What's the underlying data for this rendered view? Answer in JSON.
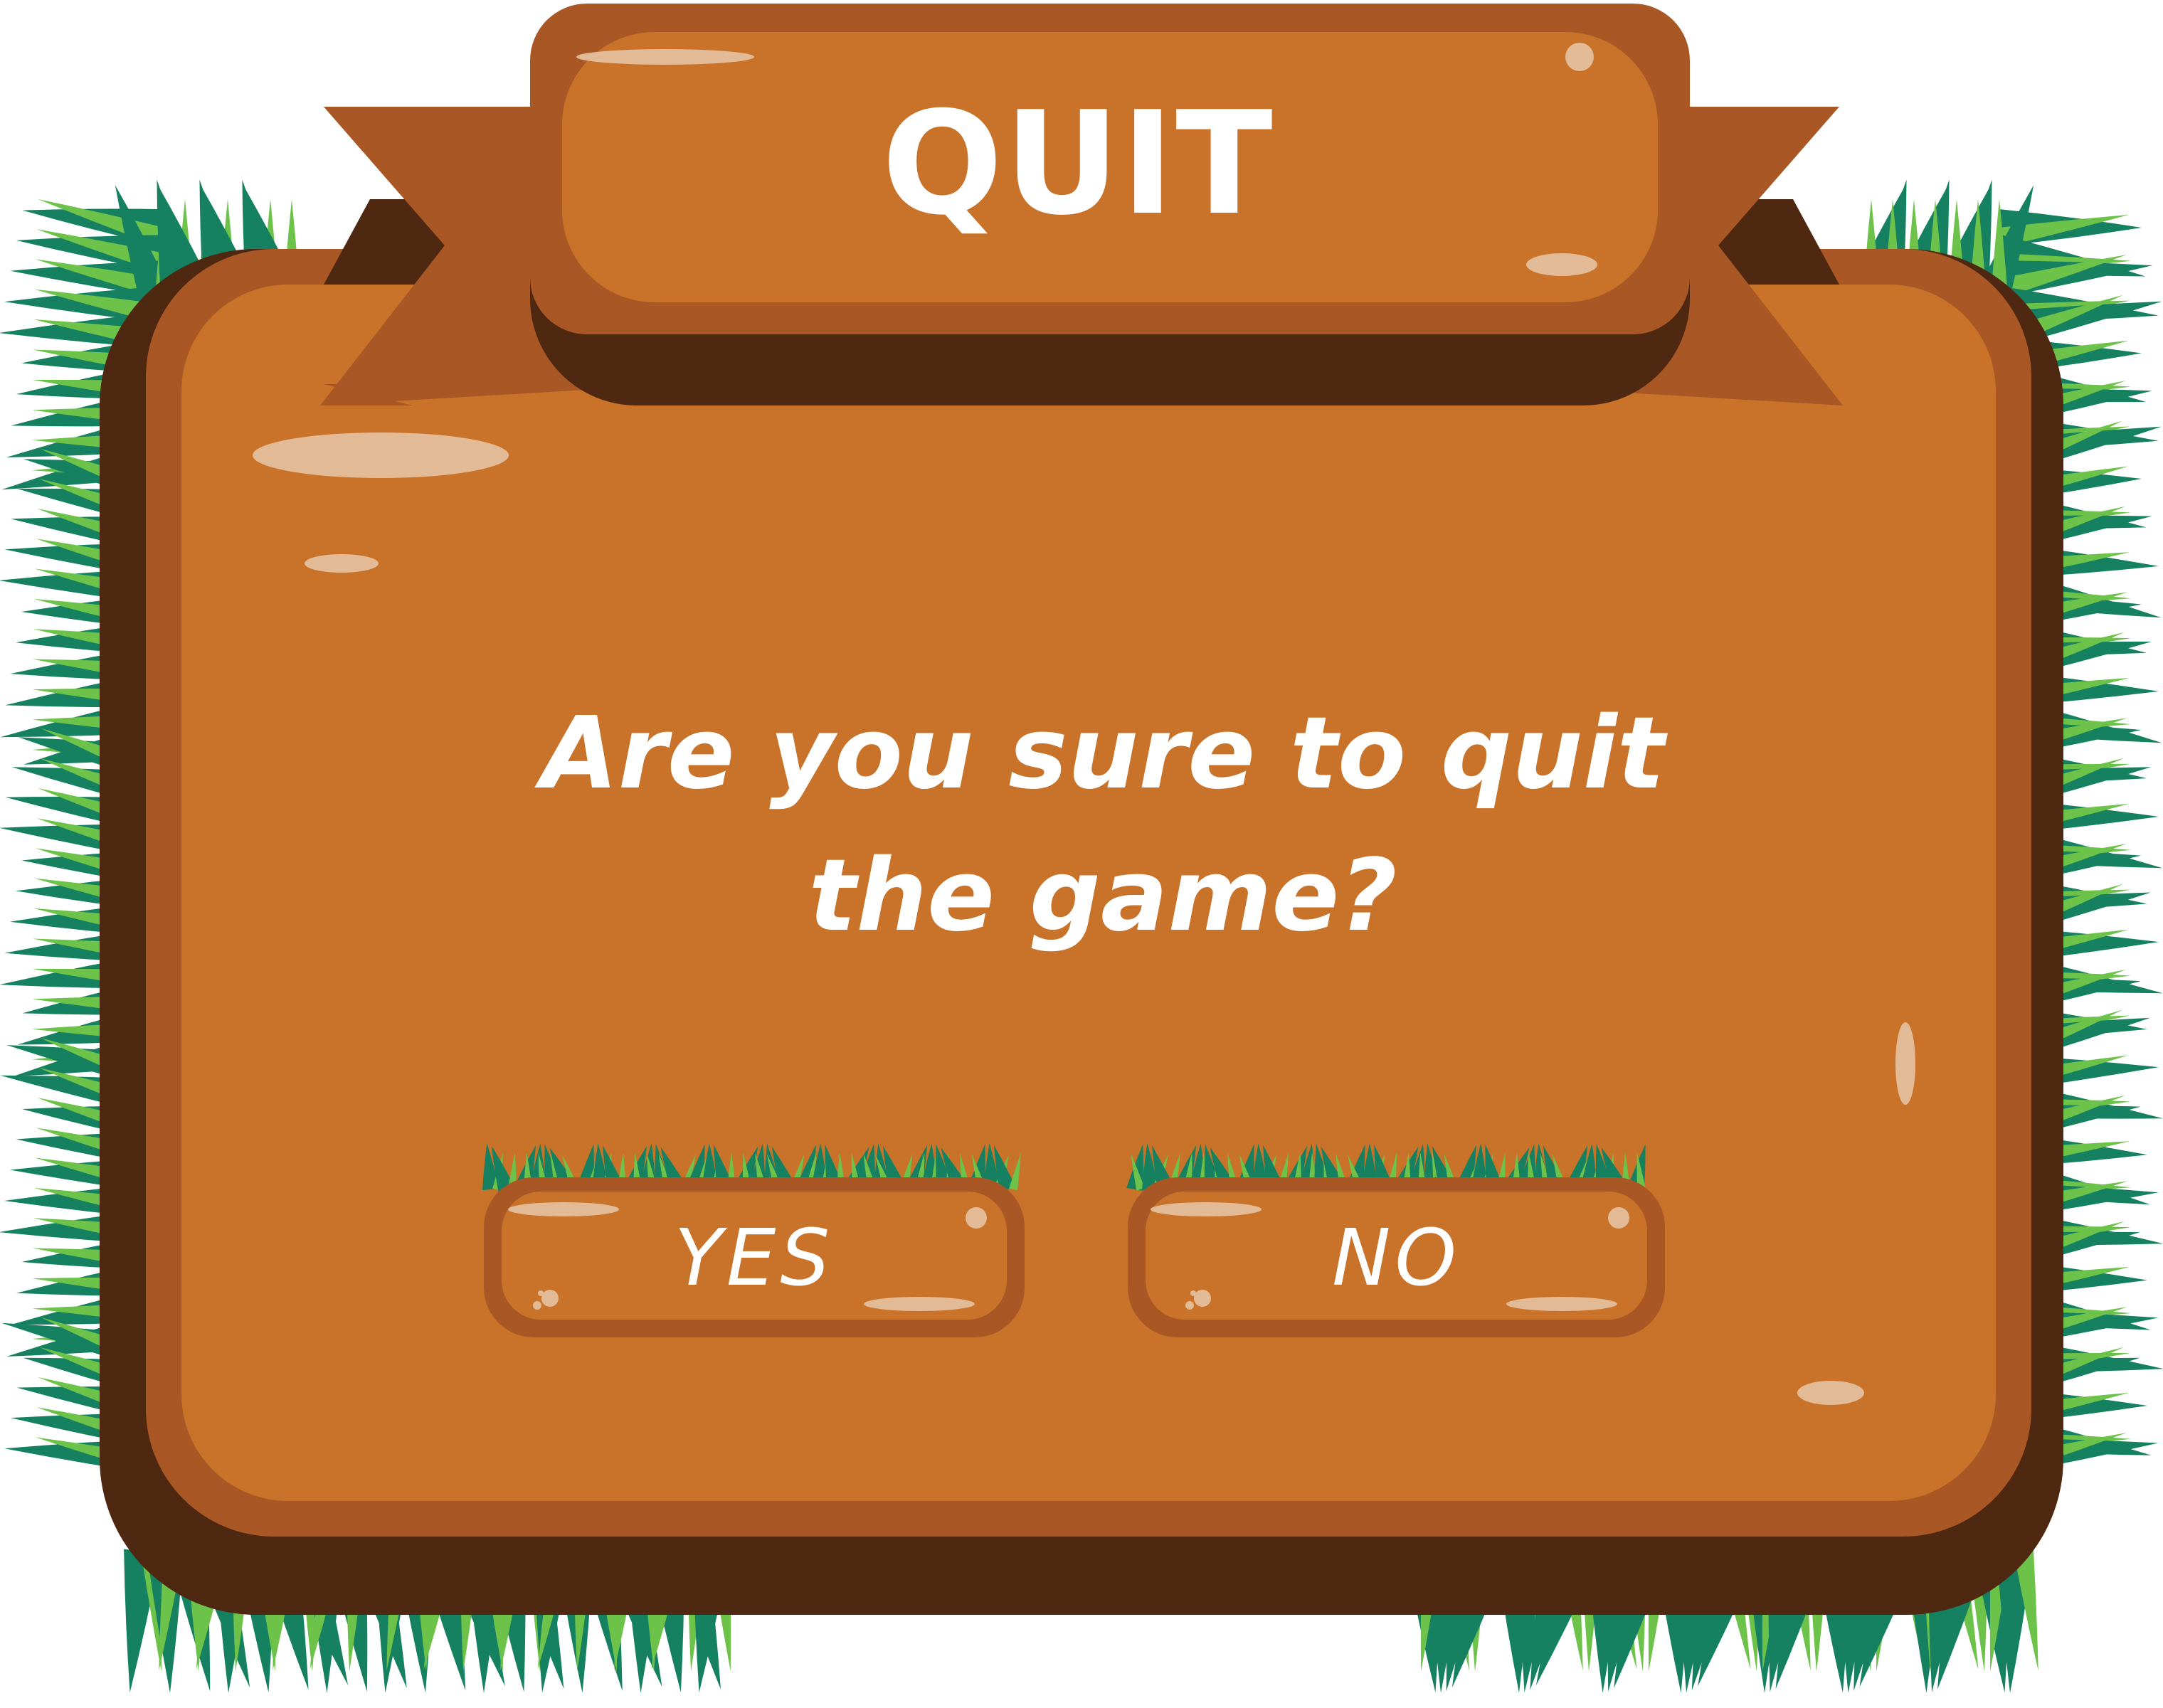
{
  "dialog": {
    "title": "QUIT",
    "message_line1": "Are you sure to quit",
    "message_line2": "the game?"
  },
  "buttons": {
    "yes_label": "YES",
    "no_label": "NO"
  },
  "colors": {
    "panel_face": "#C87329",
    "panel_rim": "#A95825",
    "panel_shadow": "#4E2810",
    "highlight": "#E3BA96",
    "grass_dark": "#168160",
    "grass_light": "#6DC24A",
    "text": "#FFFFFF"
  }
}
